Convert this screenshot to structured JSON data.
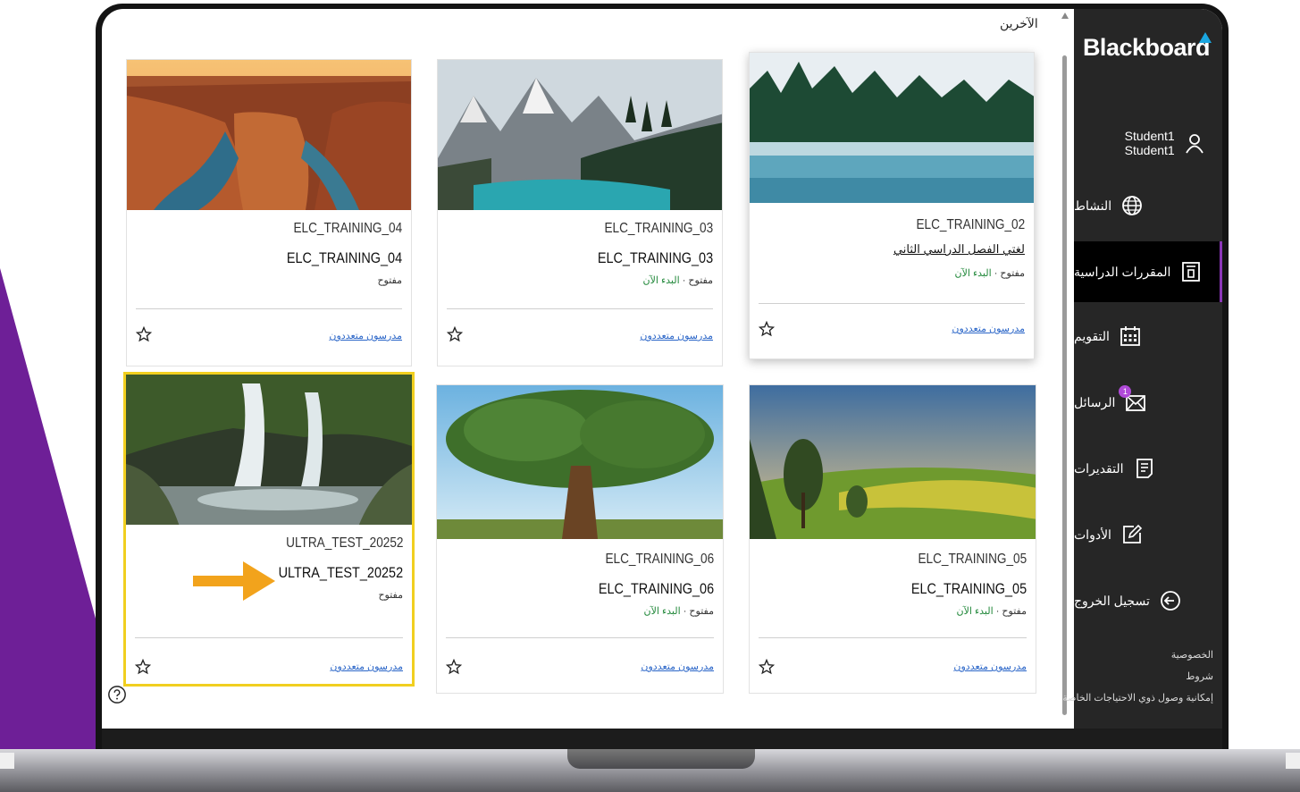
{
  "app": {
    "brand": "Blackboard",
    "section_title": "الآخرين"
  },
  "sidebar": {
    "user": "Student1 Student1",
    "items": [
      {
        "label": "النشاط",
        "icon": "globe-icon"
      },
      {
        "label": "المقررات الدراسية",
        "icon": "courses-icon",
        "active": true
      },
      {
        "label": "التقويم",
        "icon": "calendar-icon"
      },
      {
        "label": "الرسائل",
        "icon": "mail-icon",
        "badge": "1"
      },
      {
        "label": "التقديرات",
        "icon": "grades-icon"
      },
      {
        "label": "الأدوات",
        "icon": "tools-icon"
      },
      {
        "label": "تسجيل الخروج",
        "icon": "logout-icon"
      }
    ],
    "footer": [
      "الخصوصية",
      "شروط",
      "إمكانية وصول ذوي الاحتياجات الخاصة"
    ]
  },
  "courses": [
    {
      "code": "ELC_TRAINING_04",
      "name": "ELC_TRAINING_04",
      "status": "مفتوح",
      "start": "",
      "instructors": "مدرسون متعددون"
    },
    {
      "code": "ELC_TRAINING_03",
      "name": "ELC_TRAINING_03",
      "status": "مفتوح · ",
      "start": "البدء الآن",
      "instructors": "مدرسون متعددون"
    },
    {
      "code": "ELC_TRAINING_02",
      "name": "لغتي الفصل الدراسي الثاني",
      "status": "مفتوح · ",
      "start": "البدء الآن",
      "instructors": "مدرسون متعددون"
    },
    {
      "code": "ULTRA_TEST_20252",
      "name": "ULTRA_TEST_20252",
      "status": "مفتوح",
      "start": "",
      "instructors": "مدرسون متعددون"
    },
    {
      "code": "ELC_TRAINING_06",
      "name": "ELC_TRAINING_06",
      "status": "مفتوح · ",
      "start": "البدء الآن",
      "instructors": "مدرسون متعددون"
    },
    {
      "code": "ELC_TRAINING_05",
      "name": "ELC_TRAINING_05",
      "status": "مفتوح · ",
      "start": "البدء الآن",
      "instructors": "مدرسون متعددون"
    }
  ],
  "colors": {
    "purple": "#6e1f97",
    "highlight": "#f1cf1f",
    "arrow": "#f2a31c",
    "start_green": "#21883a",
    "link_blue": "#2b66c8"
  }
}
